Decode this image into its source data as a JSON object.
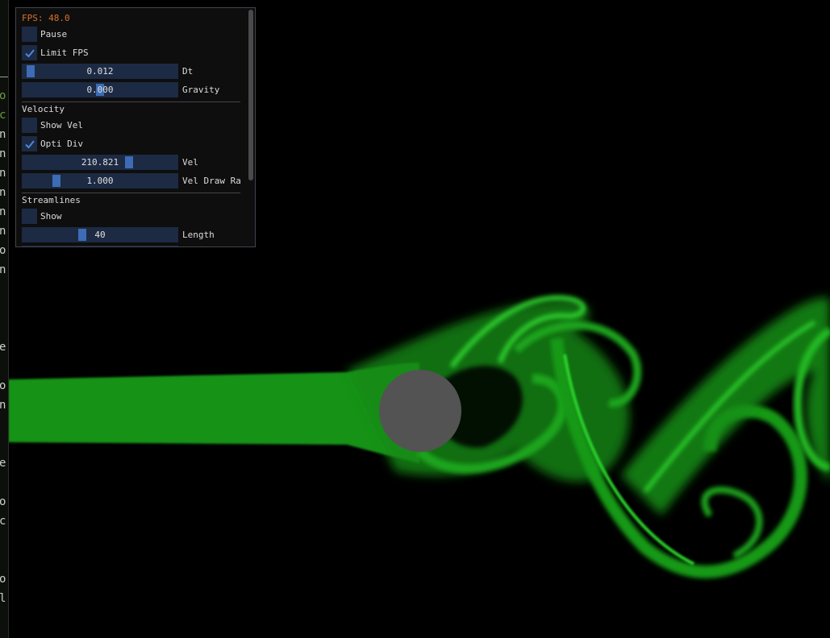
{
  "panel": {
    "fps_label": "FPS: 48.0",
    "pause": {
      "label": "Pause",
      "checked": false
    },
    "limit_fps": {
      "label": "Limit FPS",
      "checked": true
    },
    "dt": {
      "value": "0.012",
      "label": "Dt",
      "fraction": 0.02
    },
    "gravity": {
      "value": "0.000",
      "label": "Gravity",
      "fraction": 0.5
    },
    "velocity_section": "Velocity",
    "show_vel": {
      "label": "Show Vel",
      "checked": false
    },
    "opti_div": {
      "label": "Opti Div",
      "checked": true
    },
    "vel": {
      "value": "210.821",
      "label": "Vel",
      "fraction": 0.7
    },
    "vel_draw_range": {
      "value": "1.000",
      "label": "Vel Draw Ra",
      "fraction": 0.2
    },
    "streamlines_section": "Streamlines",
    "show_streamlines": {
      "label": "Show",
      "checked": false
    },
    "length": {
      "value": "40",
      "label": "Length",
      "fraction": 0.38
    }
  },
  "left_strip": {
    "glyphs": [
      "o",
      "c",
      "n",
      "n",
      "n",
      "n",
      "n",
      "n",
      "o",
      "n",
      "e",
      "o",
      "n",
      "e",
      "o",
      "c",
      "o",
      "l"
    ]
  },
  "colors": {
    "dye": "#1fa51f",
    "obstacle": "#535353",
    "panel_bg": "#0f0f0f",
    "frame_bg": "#1c2a44",
    "grab": "#3d6cb4",
    "fps_text": "#d8722a"
  }
}
